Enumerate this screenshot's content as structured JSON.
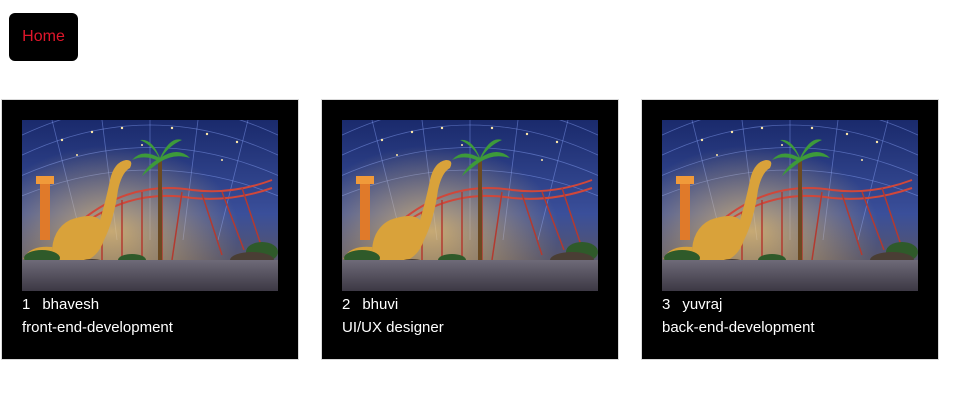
{
  "nav": {
    "home_label": "Home"
  },
  "colors": {
    "home_text": "#e0162b",
    "card_background": "#000000",
    "card_text": "#ffffff"
  },
  "cards": [
    {
      "id": "1",
      "name": "bhavesh",
      "role": "front-end-development",
      "image": "dinosaur-theme-park-photo"
    },
    {
      "id": "2",
      "name": "bhuvi",
      "role": "UI/UX designer",
      "image": "dinosaur-theme-park-photo"
    },
    {
      "id": "3",
      "name": "yuvraj",
      "role": "back-end-development",
      "image": "dinosaur-theme-park-photo"
    }
  ]
}
